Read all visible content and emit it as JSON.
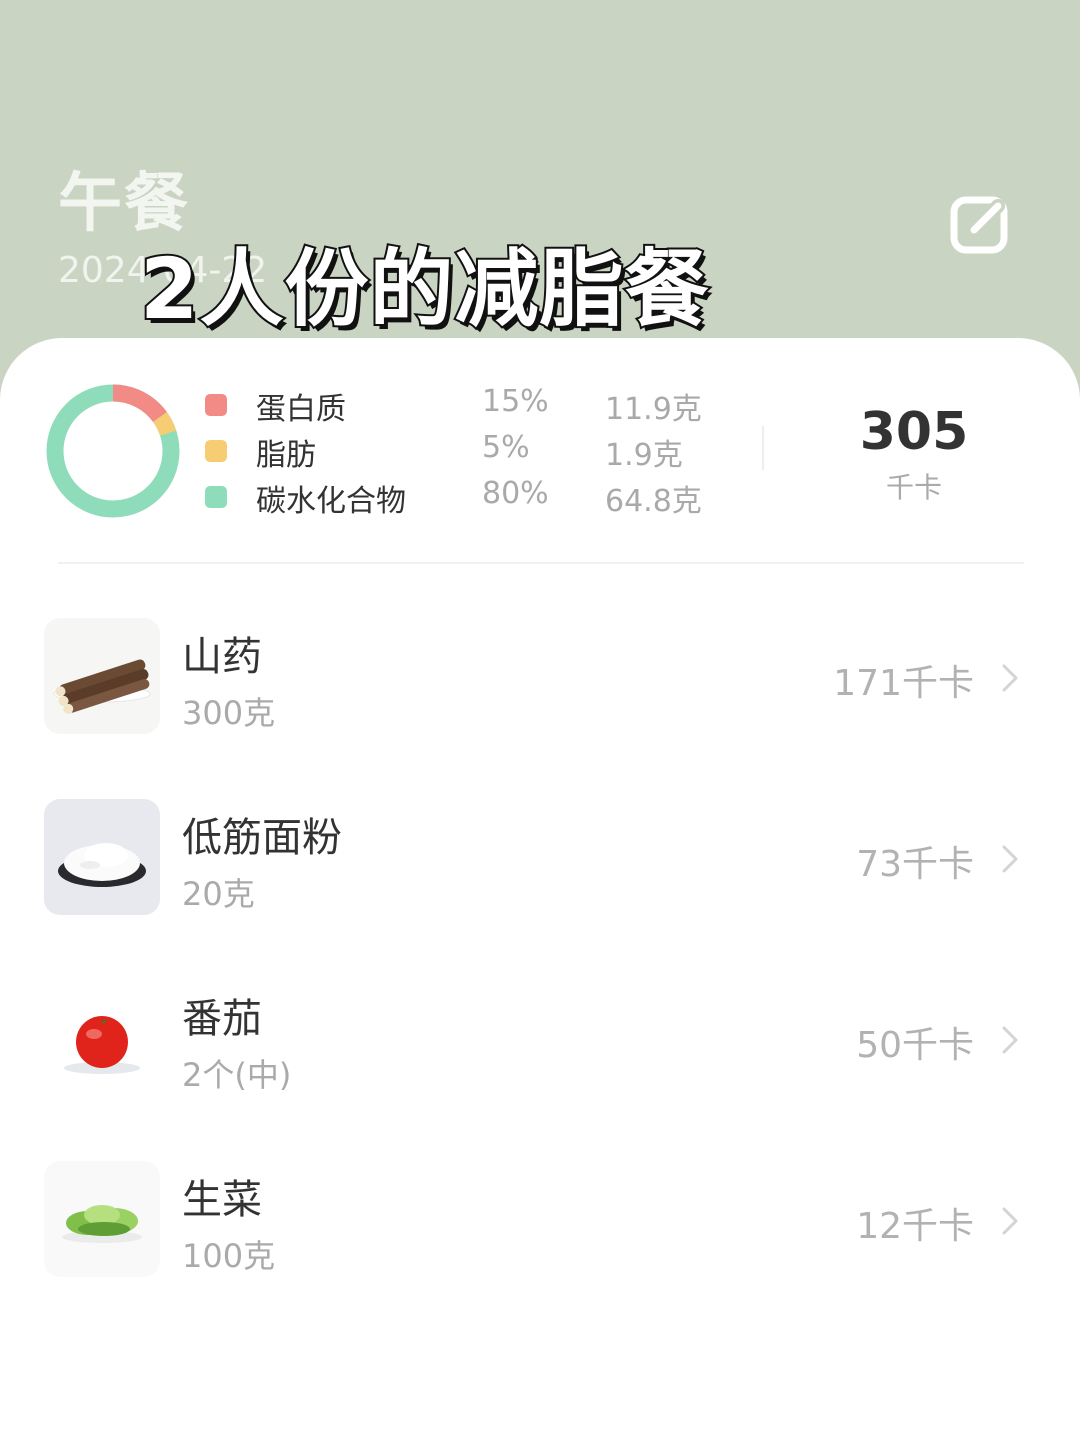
{
  "header": {
    "title": "午餐",
    "date": "2024-04-22",
    "overlay_caption": "2人份的减脂餐"
  },
  "summary": {
    "macros": [
      {
        "name": "蛋白质",
        "percent": "15%",
        "grams": "11.9克",
        "color": "#f28b85"
      },
      {
        "name": "脂肪",
        "percent": "5%",
        "grams": "1.9克",
        "color": "#f7cd74"
      },
      {
        "name": "碳水化合物",
        "percent": "80%",
        "grams": "64.8克",
        "color": "#8fdcba"
      }
    ],
    "total_kcal": "305",
    "kcal_unit": "千卡"
  },
  "foods": [
    {
      "name": "山药",
      "amount": "300克",
      "kcal": "171千卡",
      "icon": "yam-image"
    },
    {
      "name": "低筋面粉",
      "amount": "20克",
      "kcal": "73千卡",
      "icon": "flour-image"
    },
    {
      "name": "番茄",
      "amount": "2个(中)",
      "kcal": "50千卡",
      "icon": "tomato-image"
    },
    {
      "name": "生菜",
      "amount": "100克",
      "kcal": "12千卡",
      "icon": "lettuce-image"
    }
  ],
  "colors": {
    "header_bg": "#c9d4c2",
    "protein": "#f28b85",
    "fat": "#f7cd74",
    "carbs": "#8fdcba"
  }
}
